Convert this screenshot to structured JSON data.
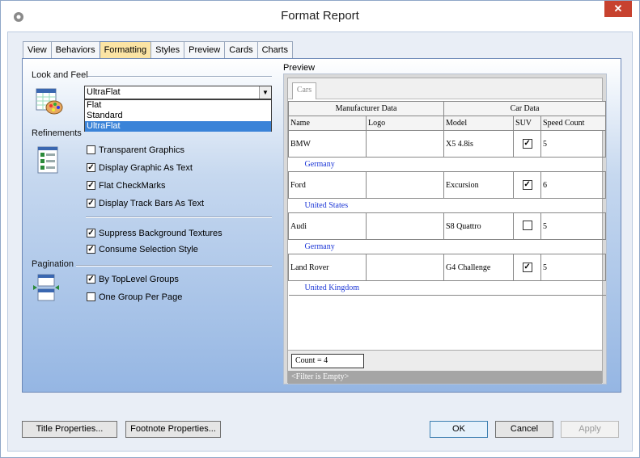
{
  "window": {
    "title": "Format Report",
    "close_glyph": "✕"
  },
  "tabs": [
    {
      "label": "View",
      "active": false
    },
    {
      "label": "Behaviors",
      "active": false
    },
    {
      "label": "Formatting",
      "active": true
    },
    {
      "label": "Styles",
      "active": false
    },
    {
      "label": "Preview",
      "active": false
    },
    {
      "label": "Cards",
      "active": false
    },
    {
      "label": "Charts",
      "active": false
    }
  ],
  "look_and_feel": {
    "label": "Look and Feel",
    "selected": "UltraFlat",
    "options": [
      "Flat",
      "Standard",
      "UltraFlat"
    ]
  },
  "refinements": {
    "label": "Refinements",
    "checks": [
      {
        "label": "Transparent Graphics",
        "checked": false
      },
      {
        "label": "Display Graphic As Text",
        "checked": true
      },
      {
        "label": "Flat CheckMarks",
        "checked": true
      },
      {
        "label": "Display Track Bars As Text",
        "checked": true
      },
      {
        "label": "Suppress Background Textures",
        "checked": true
      },
      {
        "label": "Consume Selection Style",
        "checked": true
      }
    ]
  },
  "pagination": {
    "label": "Pagination",
    "checks": [
      {
        "label": "By TopLevel Groups",
        "checked": true
      },
      {
        "label": "One Group Per Page",
        "checked": false
      }
    ]
  },
  "preview": {
    "label": "Preview",
    "tab": "Cars",
    "band_headers": [
      "Manufacturer Data",
      "Car Data"
    ],
    "columns": [
      "Name",
      "Logo",
      "Model",
      "SUV",
      "Speed Count"
    ],
    "rows": [
      {
        "name": "BMW",
        "logo": "",
        "model": "X5 4.8is",
        "suv": true,
        "speed": "5",
        "country": "Germany"
      },
      {
        "name": "Ford",
        "logo": "",
        "model": "Excursion",
        "suv": true,
        "speed": "6",
        "country": "United States"
      },
      {
        "name": "Audi",
        "logo": "",
        "model": "S8 Quattro",
        "suv": false,
        "speed": "5",
        "country": "Germany"
      },
      {
        "name": "Land Rover",
        "logo": "",
        "model": "G4 Challenge",
        "suv": true,
        "speed": "5",
        "country": "United Kingdom"
      }
    ],
    "count_text": "Count = 4",
    "filter_text": "<Filter is Empty>"
  },
  "buttons": {
    "title_props": "Title Properties...",
    "footnote_props": "Footnote Properties...",
    "ok": "OK",
    "cancel": "Cancel",
    "apply": "Apply"
  },
  "check_glyph": "✓"
}
